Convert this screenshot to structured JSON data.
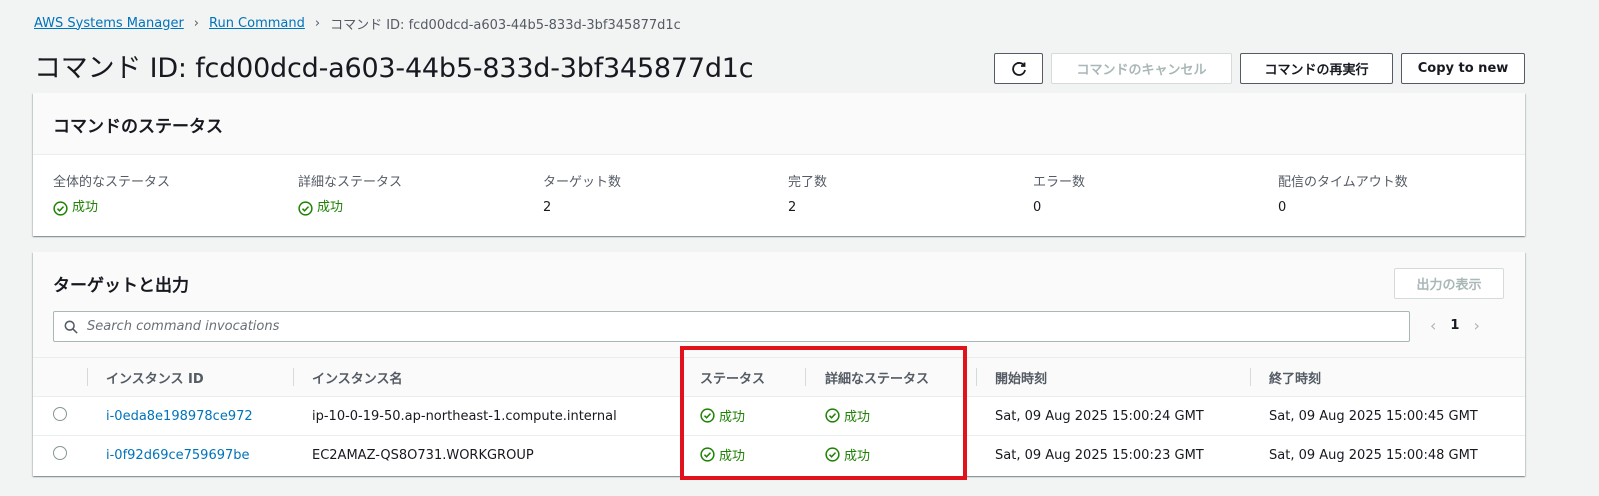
{
  "breadcrumb": {
    "item1": "AWS Systems Manager",
    "item2": "Run Command",
    "current": "コマンド ID: fcd00dcd-a603-44b5-833d-3bf345877d1c"
  },
  "title": "コマンド ID: fcd00dcd-a603-44b5-833d-3bf345877d1c",
  "header_buttons": {
    "cancel": "コマンドのキャンセル",
    "rerun": "コマンドの再実行",
    "copy": "Copy to new"
  },
  "status_panel": {
    "title": "コマンドのステータス",
    "stats": [
      {
        "label": "全体的なステータス",
        "value": "成功"
      },
      {
        "label": "詳細なステータス",
        "value": "成功"
      },
      {
        "label": "ターゲット数",
        "value": "2"
      },
      {
        "label": "完了数",
        "value": "2"
      },
      {
        "label": "エラー数",
        "value": "0"
      },
      {
        "label": "配信のタイムアウト数",
        "value": "0"
      }
    ]
  },
  "targets": {
    "title": "ターゲットと出力",
    "show_output": "出力の表示",
    "search_placeholder": "Search command invocations",
    "page": "1",
    "columns": [
      "インスタンス ID",
      "インスタンス名",
      "ステータス",
      "詳細なステータス",
      "開始時刻",
      "終了時刻"
    ],
    "rows": [
      {
        "instance_id": "i-0eda8e198978ce972",
        "instance_name": "ip-10-0-19-50.ap-northeast-1.compute.internal",
        "status": "成功",
        "detailed_status": "成功",
        "start": "Sat, 09 Aug 2025 15:00:24 GMT",
        "end": "Sat, 09 Aug 2025 15:00:45 GMT"
      },
      {
        "instance_id": "i-0f92d69ce759697be",
        "instance_name": "EC2AMAZ-QS8O731.WORKGROUP",
        "status": "成功",
        "detailed_status": "成功",
        "start": "Sat, 09 Aug 2025 15:00:23 GMT",
        "end": "Sat, 09 Aug 2025 15:00:48 GMT"
      }
    ]
  },
  "colors": {
    "link": "#0073bb",
    "success": "#1d8102",
    "highlight": "#e0121b"
  }
}
